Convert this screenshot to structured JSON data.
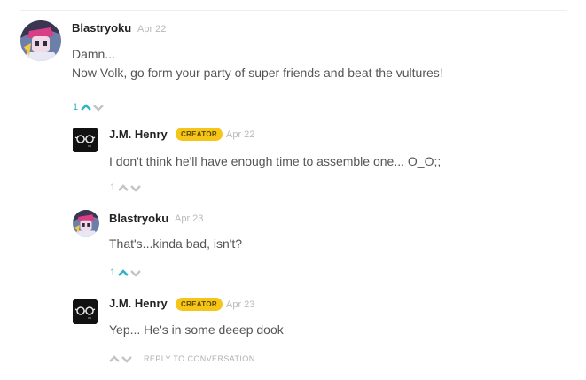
{
  "colors": {
    "accent": "#2fb3c6",
    "muted": "#b9b9b9",
    "creator_badge": "#f5c518"
  },
  "comments": [
    {
      "author": "Blastryoku",
      "date": "Apr 22",
      "lines": [
        "Damn...",
        "Now Volk, go form your party of super friends and beat the vultures!"
      ],
      "votes": "1",
      "upvoted": true,
      "avatar_icon": "anime-character-avatar-icon"
    },
    {
      "author": "J.M. Henry",
      "badge": "CREATOR",
      "date": "Apr 22",
      "lines": [
        "I don't think he'll have enough time to assemble one... O_O;;"
      ],
      "votes": "1",
      "upvoted": false,
      "avatar_icon": "glasses-avatar-icon"
    },
    {
      "author": "Blastryoku",
      "date": "Apr 23",
      "lines": [
        "That's...kinda bad, isn't?"
      ],
      "votes": "1",
      "upvoted": true,
      "avatar_icon": "anime-character-avatar-icon"
    },
    {
      "author": "J.M. Henry",
      "badge": "CREATOR",
      "date": "Apr 23",
      "lines": [
        "Yep... He's in some deeep dook"
      ],
      "reply_label": "REPLY TO CONVERSATION",
      "avatar_icon": "glasses-avatar-icon"
    }
  ]
}
